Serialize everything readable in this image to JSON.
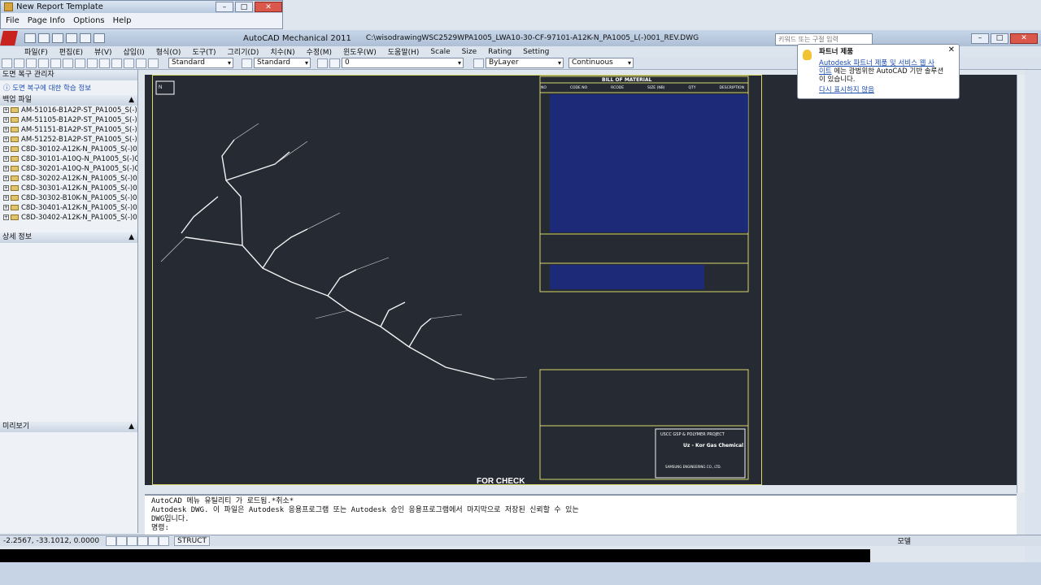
{
  "report": {
    "title": "New Report Template",
    "menu": [
      "File",
      "Page Info",
      "Options",
      "Help"
    ]
  },
  "app": {
    "title": "AutoCAD Mechanical 2011",
    "file": "C:\\wisodrawingWSC2529WPA1005_LWA10-30-CF-97101-A12K-N_PA1005_L(-)001_REV.DWG",
    "search_placeholder": "키워드 또는 구절 입력"
  },
  "menu": [
    "파일(F)",
    "편집(E)",
    "뷰(V)",
    "삽입(I)",
    "형식(O)",
    "도구(T)",
    "그리기(D)",
    "치수(N)",
    "수정(M)",
    "윈도우(W)",
    "도움말(H)",
    "Scale",
    "Size",
    "Rating",
    "Setting"
  ],
  "toolbar": {
    "style1": "Standard",
    "style2": "Standard",
    "layer": "0",
    "bylayer": "ByLayer",
    "continuous": "Continuous"
  },
  "left_panel": {
    "header": "도면 복구 관리자",
    "info": "도면 복구에 대한 학습 정보",
    "backup": "백업 파일",
    "files": [
      "AM-51016-B1A2P-ST_PA1005_S(-)0",
      "AM-51105-B1A2P-ST_PA1005_S(-)0",
      "AM-51151-B1A2P-ST_PA1005_S(-)0",
      "AM-51252-B1A2P-ST_PA1005_S(-)0",
      "C8D-30102-A12K-N_PA1005_S(-)0",
      "C8D-30101-A10Q-N_PA1005_S(-)0",
      "C8D-30201-A10Q-N_PA1005_S(-)0",
      "C8D-30202-A12K-N_PA1005_S(-)0",
      "C8D-30301-A12K-N_PA1005_S(-)0",
      "C8D-30302-B10K-N_PA1005_S(-)0",
      "C8D-30401-A12K-N_PA1005_S(-)0",
      "C8D-30402-A12K-N_PA1005_S(-)0"
    ],
    "detail": "상세 정보",
    "preview": "미리보기"
  },
  "drawing": {
    "bom_title": "BILL OF MATERIAL",
    "stamp": "FOR CHECK",
    "project": "USCC GSP & POLYMER PROJECT",
    "company": "Uz - Kor Gas Chemical",
    "contractor": "SAMSUNG ENGINEERING CO., LTD.",
    "bom_headers": [
      "NO",
      "CODE NO",
      "RCODE",
      "SIZE (NB)",
      "QTY",
      "DESCRIPTION"
    ]
  },
  "command": {
    "lines": [
      "AutoCAD 메뉴 유틸리티 가 로드됨.*취소*",
      "Autodesk DWG.  이 파일은 Autodesk 응용프로그램 또는 Autodesk 승인 응용프로그램에서 마지막으로 저장된 신뢰할 수 있는",
      "DWG입니다.",
      "명령:"
    ]
  },
  "status": {
    "coords": "-2.2567, -33.1012, 0.0000",
    "struct": "STRUCT",
    "model": "모델"
  },
  "balloon": {
    "title": "파트너 제품",
    "line1": "Autodesk 파트너 제품 및 서비스 웹 사",
    "line2": "이트",
    "line2b": "에는 광범위한 AutoCAD 기반 솔루션",
    "line3": "이 있습니다.",
    "dismiss": "다시 표시하지 않음"
  }
}
